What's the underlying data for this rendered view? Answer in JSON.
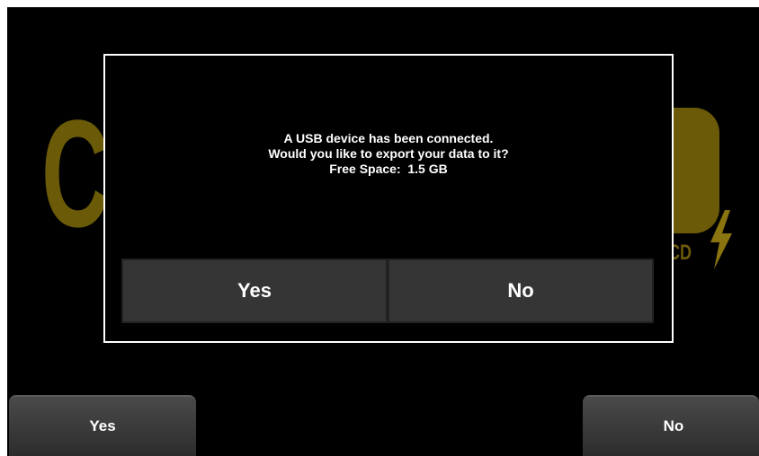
{
  "background_logo": {
    "left_glyph": "C",
    "right_subtext": "CD",
    "color": "#6b5a08",
    "bolt_icon": "lightning-bolt-icon"
  },
  "dialog": {
    "message_lines": [
      "A USB device has been connected.",
      "Would you like to export your data to it?",
      "Free Space:  1.5 GB"
    ],
    "yes_label": "Yes",
    "no_label": "No",
    "border_color": "#ffffff",
    "button_color": "#353535"
  },
  "soft_keys": {
    "left_label": "Yes",
    "right_label": "No"
  },
  "colors": {
    "screen_background": "#000000",
    "text": "#ffffff"
  }
}
